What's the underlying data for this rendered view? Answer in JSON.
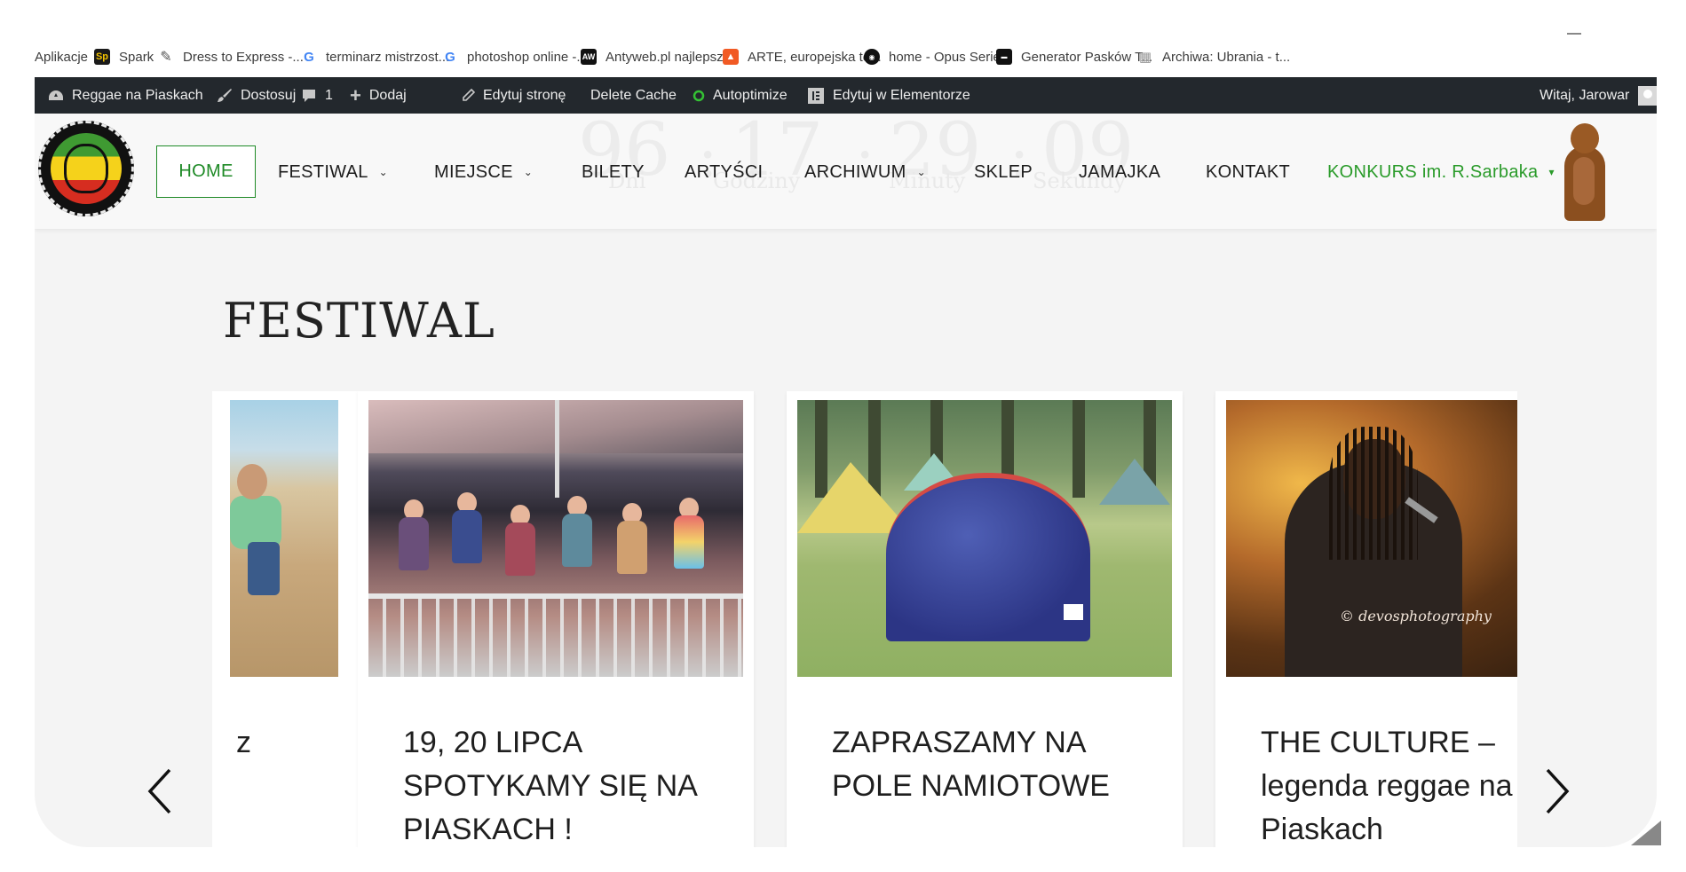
{
  "bookmarks": [
    {
      "label": "Aplikacje",
      "icon": "apps-icon"
    },
    {
      "label": "Spark",
      "icon": "spark-icon",
      "badge": "Sp"
    },
    {
      "label": "Dress to Express -...",
      "icon": "dress-icon"
    },
    {
      "label": "terminarz mistrzost...",
      "icon": "google-icon",
      "badge": "G"
    },
    {
      "label": "photoshop online -...",
      "icon": "google-icon",
      "badge": "G"
    },
    {
      "label": "Antyweb.pl najlepsz...",
      "icon": "antyweb-icon",
      "badge": "AW"
    },
    {
      "label": "ARTE, europejska te...",
      "icon": "arte-icon"
    },
    {
      "label": "home - Opus Series",
      "icon": "opus-icon"
    },
    {
      "label": "Generator Pasków T...",
      "icon": "generator-icon"
    },
    {
      "label": "Archiwa: Ubrania - t...",
      "icon": "archive-icon"
    }
  ],
  "adminbar": {
    "site": "Reggae na Piaskach",
    "customize": "Dostosuj",
    "comments": "1",
    "add": "Dodaj",
    "edit_page": "Edytuj stronę",
    "delete_cache": "Delete Cache",
    "autoptimize": "Autoptimize",
    "elementor": "Edytuj w Elementorze",
    "greeting": "Witaj, Jarowar"
  },
  "countdown": {
    "days": "96",
    "days_label": "Dni",
    "hours": "17",
    "hours_label": "Godziny",
    "minutes": "29",
    "minutes_label": "Minuty",
    "seconds": "09",
    "seconds_label": "Sekundy"
  },
  "nav": {
    "home": "HOME",
    "festiwal": "FESTIWAL",
    "miejsce": "MIEJSCE",
    "bilety": "BILETY",
    "artysci": "ARTYŚCI",
    "archiwum": "ARCHIWUM",
    "sklep": "SKLEP",
    "jamajka": "JAMAJKA",
    "kontakt": "KONTAKT",
    "konkurs": "KONKURS im. R.Sarbaka"
  },
  "page": {
    "title": "FESTIWAL"
  },
  "cards": [
    {
      "title": "z"
    },
    {
      "title": "19, 20 LIPCA SPOTYKAMY SIĘ NA PIASKACH !"
    },
    {
      "title": "ZAPRASZAMY NA POLE NAMIOTOWE"
    },
    {
      "title": "THE CULTURE – legenda reggae na Piaskach",
      "photo_credit": "© devosphotography"
    }
  ],
  "colors": {
    "accent_green": "#1e8a26",
    "admin_bar": "#23282d"
  }
}
